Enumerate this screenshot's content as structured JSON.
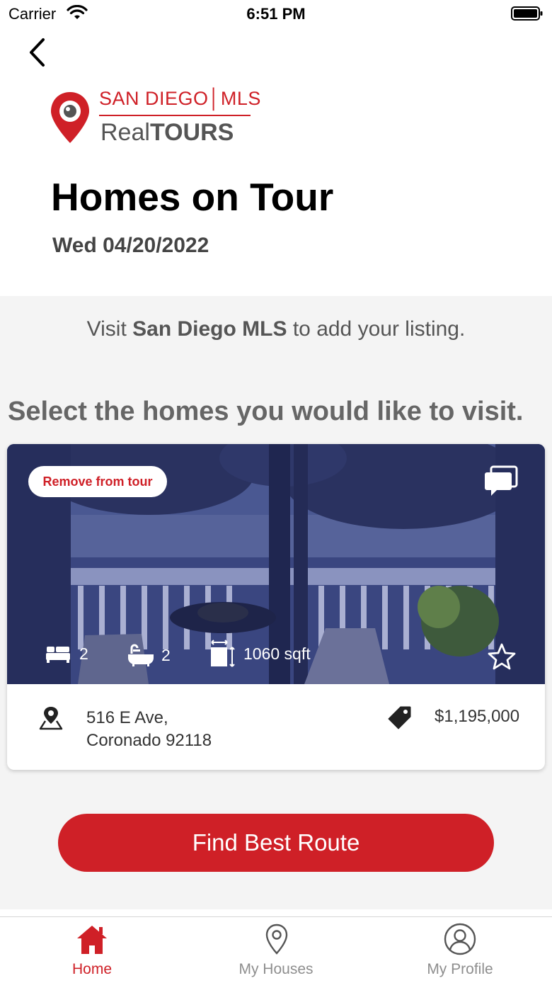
{
  "status_bar": {
    "carrier": "Carrier",
    "time": "6:51 PM"
  },
  "logo": {
    "line1": "SAN DIEGO│MLS",
    "line2_part1": "Real",
    "line2_part2": "TOURS"
  },
  "header": {
    "title": "Homes on Tour",
    "date": "Wed 04/20/2022"
  },
  "notice": {
    "prefix": "Visit ",
    "link": "San Diego MLS",
    "suffix": " to add your listing."
  },
  "instructions": "Select the homes you would like to visit.",
  "listing": {
    "remove_label": "Remove from tour",
    "beds": "2",
    "baths": "2",
    "sqft": "1060 sqft",
    "address_line1": "516 E Ave,",
    "address_line2": "Coronado 92118",
    "price": "$1,195,000",
    "favorited": false
  },
  "actions": {
    "route_label": "Find Best Route"
  },
  "tabs": [
    {
      "label": "Home",
      "icon": "home-icon",
      "active": true
    },
    {
      "label": "My Houses",
      "icon": "location-pin-icon",
      "active": false
    },
    {
      "label": "My Profile",
      "icon": "user-profile-icon",
      "active": false
    }
  ],
  "colors": {
    "brand_red": "#cf2027",
    "photo_tint": "#2e3a78",
    "background_gray": "#f4f4f4"
  }
}
